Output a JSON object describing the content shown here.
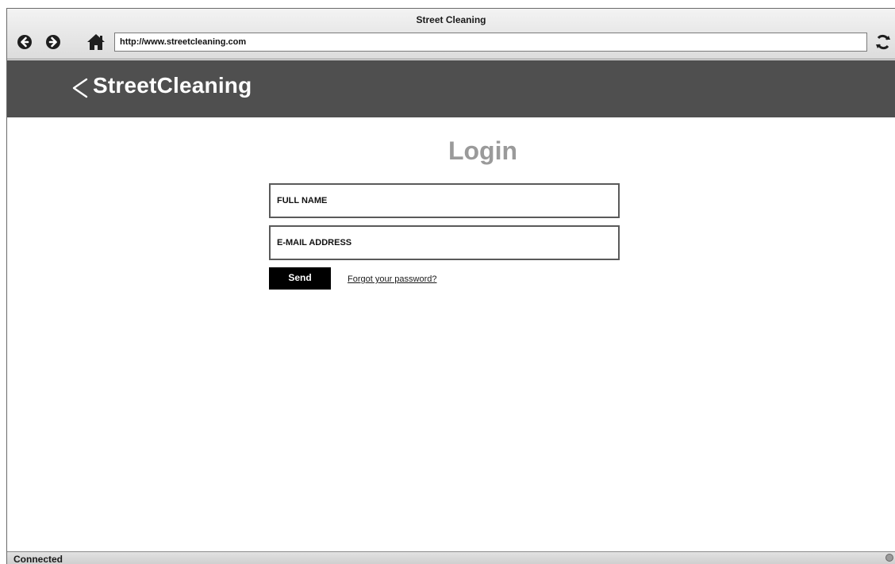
{
  "window": {
    "title": "Street Cleaning"
  },
  "toolbar": {
    "url": "http://www.streetcleaning.com",
    "back_icon": "back-arrow-circle",
    "forward_icon": "forward-arrow-circle",
    "home_icon": "home",
    "reload_icon": "refresh"
  },
  "header": {
    "back_icon": "chevron-left",
    "brand": "StreetCleaning",
    "background_color": "#4f4f4f"
  },
  "login": {
    "title": "Login",
    "full_name_placeholder": "FULL NAME",
    "email_placeholder": "E-MAIL ADDRESS",
    "send_label": "Send",
    "forgot_label": "Forgot your password?"
  },
  "status": {
    "text": "Connected"
  }
}
